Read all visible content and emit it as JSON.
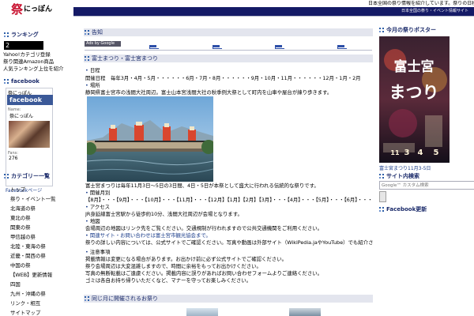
{
  "site": {
    "logo_mark": "祭",
    "logo_text": "にっぽん",
    "top_description": "日本全国の祭り情報を紹介しています。祭りの日程・開催場所・見どころなど。",
    "header_subtitle": "日本全国の祭り・イベント情報サイト"
  },
  "left": {
    "ranking_heading": "ランキング",
    "ranking_value": "2",
    "ranking_lines": [
      "Yahoo!カテゴリ登録",
      "祭り関連Amazon商品",
      "人気ランキング上位を紹介"
    ],
    "facebook_heading": "facebook",
    "facebook_widget": {
      "top_label": "祭にっぽん",
      "bar_label": "facebook",
      "name_label": "Name:",
      "page_name": "祭にっぽん",
      "fans_label": "Fans:",
      "fans_value": "276",
      "link_text": "Facebookページ"
    },
    "categories_heading": "カテゴリー一覧",
    "categories": [
      "トップ",
      "祭り・イベント一覧",
      "北海道の祭",
      "東北の祭",
      "関東の祭",
      "甲信越の祭",
      "北陸・東海の祭",
      "近畿・関西の祭",
      "中国の祭",
      "【WEB】更新情報",
      "四国",
      "九州・沖縄の祭",
      "リンク・相互",
      "サイトマップ"
    ]
  },
  "main": {
    "notice_heading": "告知",
    "ads_label": "Ads by Google",
    "article_heading": "富士まつり・富士宮まつり",
    "lines": {
      "date_bullet": "日程",
      "date_text": "開催日程　毎年3月・4月・5月・・・・・・6月・7月・8月・・・・・・9月・10月・11月・・・・・・12月・1月・2月",
      "place_bullet": "場所",
      "place_text": "静岡県富士宮市の浅間大社周辺。富士山本宮浅間大社の秋季例大祭として町内を山車や屋台が練り歩きます。",
      "after_photo": "富士宮まつりは毎年11月3日〜5日の3日間、4日・5日が本祭として盛大に行われる伝統的な祭りです。",
      "months_bullet": "開催月別",
      "months_text": "【8月】・・・【9月】・・・【10月】・・・【11月】・・・【12月】【1月】【2月】【3月】・・・【4月】・・・【5月】・・・【6月】・・・【7月】",
      "access_bullet": "アクセス",
      "access_text": "JR身延線富士宮駅から徒歩約10分、浅間大社周辺が会場となります。",
      "map_bullet": "地図",
      "map_text": "会場周辺の地図はリンク先をご覧ください。交通規制が行われますので公共交通機関をご利用ください。",
      "related_bullet": "関連サイト・お問い合わせは富士宮市観光協会まで。",
      "related_text": "祭りの詳しい内容については、公式サイトでご確認ください。写真や動画は外部サイト（WikiPedia.jaやYouTube）でも紹介されています。",
      "notes_bullet": "注意事項",
      "notes_1": "掲載情報は変更になる場合があります。お出かけ前に必ず公式サイトでご確認ください。",
      "notes_2": "祭り会場周辺は大変混雑しますので、時間に余裕をもってお出かけください。",
      "notes_3": "写真の無断転載はご遠慮ください。掲載内容に誤りがあればお問い合わせフォームよりご連絡ください。",
      "notes_4": "ゴミは各自お持ち帰りいただくなど、マナーを守ってお楽しみください。"
    },
    "related_heading": "同じ月に開催されるお祭り"
  },
  "right": {
    "poster_heading": "今月の祭りポスター",
    "poster_title": "富士宮まつり",
    "poster_dates": [
      "11",
      "3",
      "4",
      "5"
    ],
    "poster_caption": "富士宮まつり11月3-5日",
    "search_heading": "サイト内検索",
    "search_placeholder": "Google™ カスタム検索",
    "fb_recent_heading": "Facebook更新"
  },
  "colors": {
    "header_bar": "#141a66",
    "accent_link": "#1a3c8a",
    "logo_red": "#c8102e",
    "facebook_blue": "#3b5998"
  }
}
